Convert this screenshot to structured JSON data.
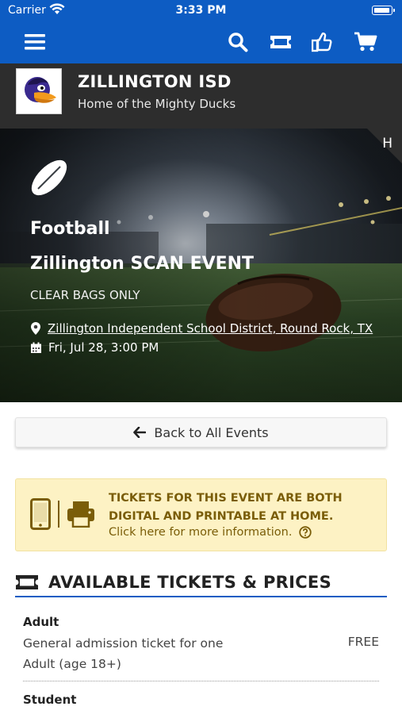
{
  "status_bar": {
    "carrier": "Carrier",
    "time": "3:33 PM"
  },
  "nav": {
    "icons": [
      "hamburger-menu-icon",
      "search-icon",
      "ticket-icon",
      "thumbs-up-icon",
      "cart-icon"
    ],
    "color": "#0d5cc3"
  },
  "school": {
    "name": "ZILLINGTON ISD",
    "tagline": "Home of the Mighty Ducks"
  },
  "hero": {
    "corner_label": "H",
    "sport": "Football",
    "event_title": "Zillington SCAN EVENT",
    "note": "CLEAR BAGS ONLY",
    "location": "Zillington Independent School District, Round Rock, TX",
    "datetime": "Fri, Jul 28, 3:00 PM"
  },
  "back_button": {
    "label": "Back to All Events"
  },
  "info_box": {
    "headline": "TICKETS FOR THIS EVENT ARE BOTH DIGITAL AND PRINTABLE AT HOME.",
    "link": "Click here for more information.",
    "bg_color": "#fdf2c4",
    "text_color": "#7a5d08"
  },
  "tickets": {
    "heading": "AVAILABLE TICKETS & PRICES",
    "items": [
      {
        "name": "Adult",
        "description": "General admission ticket for one Adult (age 18+)",
        "price": "FREE"
      },
      {
        "name": "Student"
      }
    ]
  }
}
